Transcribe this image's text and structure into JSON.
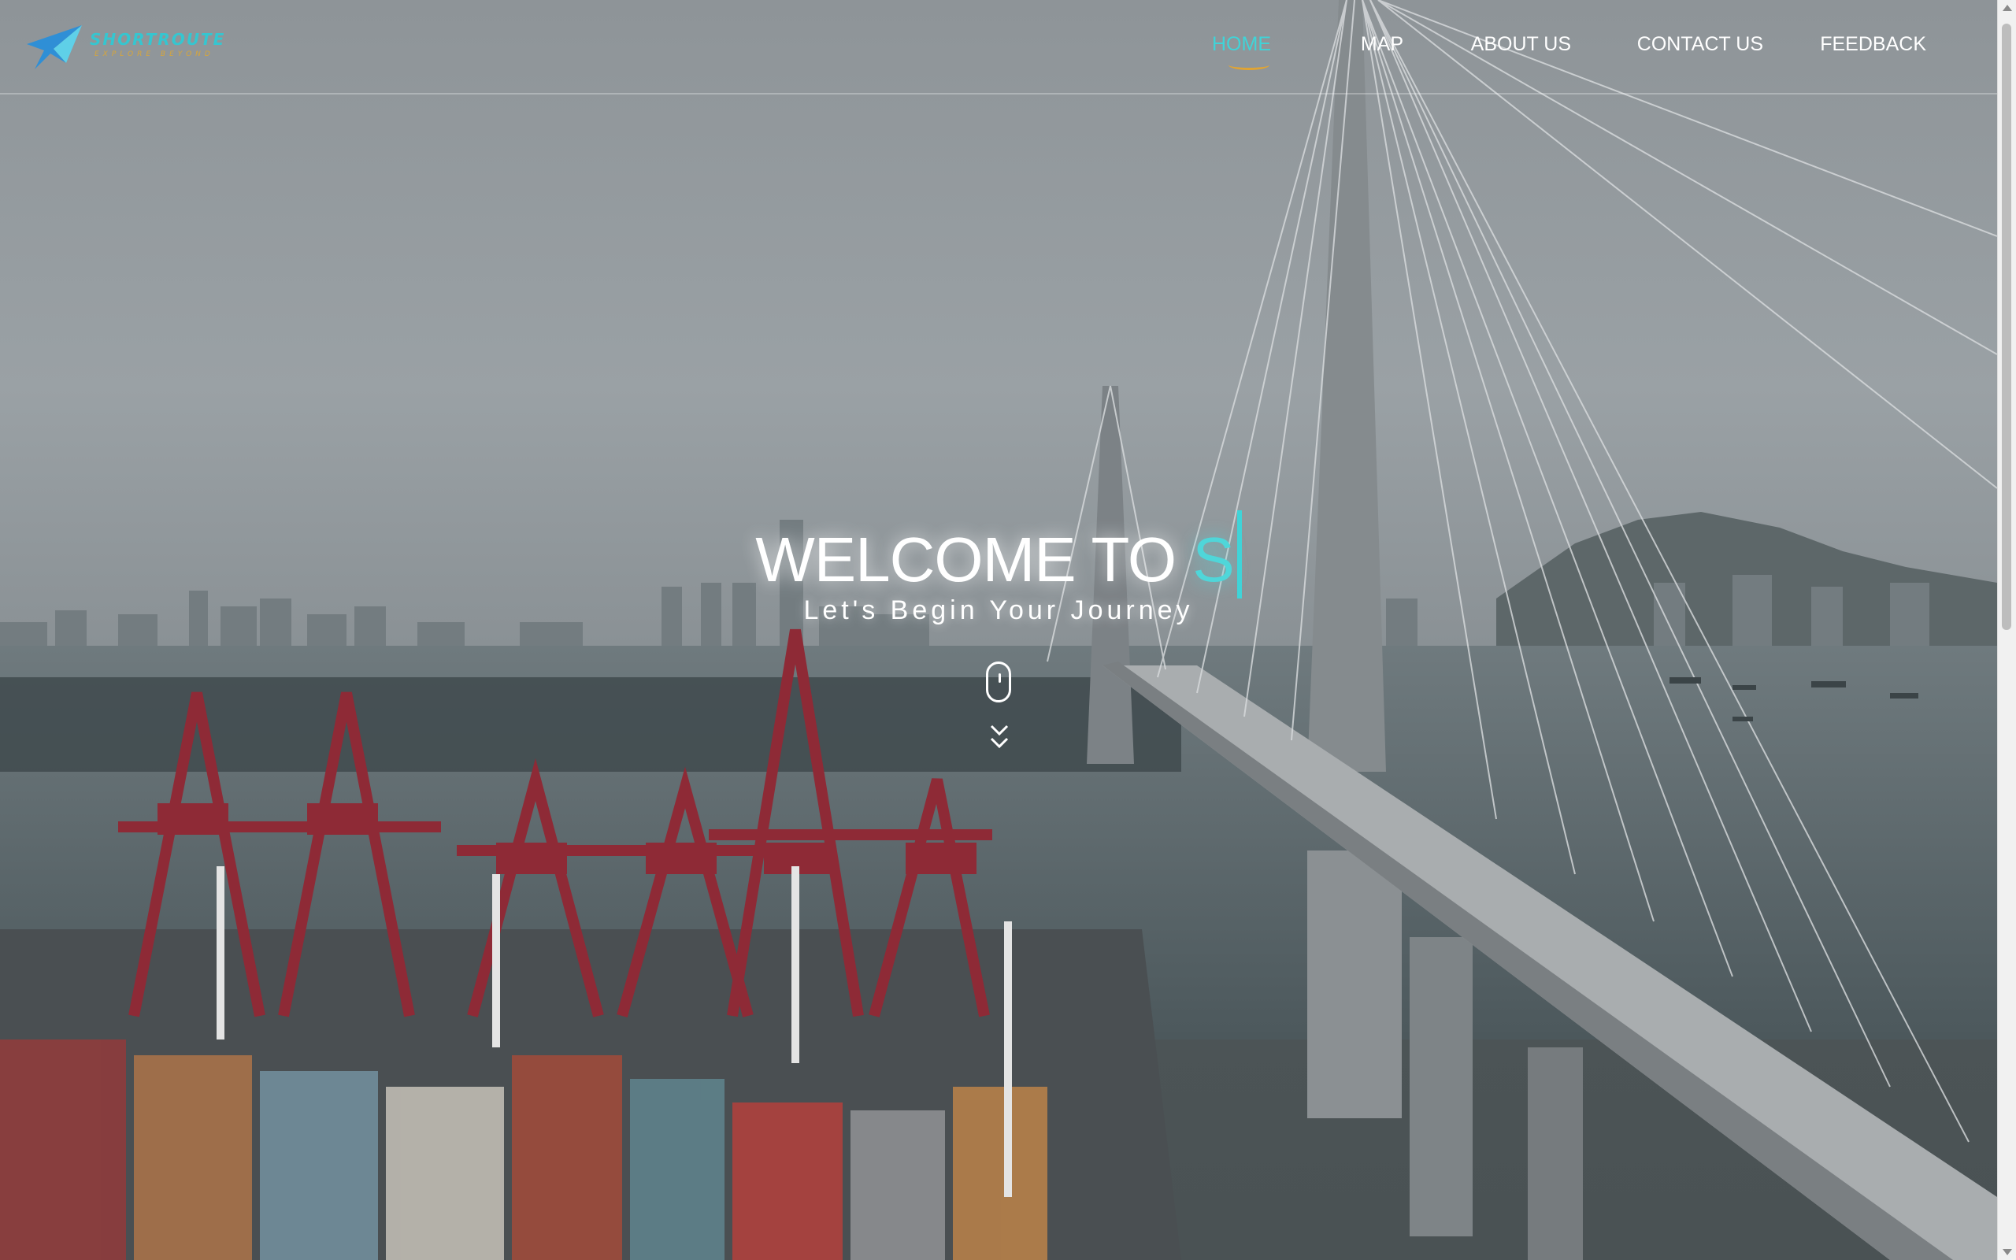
{
  "brand": {
    "name": "SHORTROUTE",
    "tagline": "EXPLORE BEYOND"
  },
  "nav": {
    "items": [
      {
        "label": "HOME",
        "active": true
      },
      {
        "label": "MAP",
        "active": false
      },
      {
        "label": "ABOUT US",
        "active": false
      },
      {
        "label": "CONTACT US",
        "active": false
      },
      {
        "label": "FEEDBACK",
        "active": false
      }
    ]
  },
  "hero": {
    "welcome": "WELCOME TO",
    "typed": "S",
    "subtitle": "Let's Begin Your Journey",
    "scroll_icon": "mouse-scroll-icon",
    "scroll_arrow_icon": "chevron-down-double-icon"
  },
  "colors": {
    "accent": "#3fd4d8",
    "underline": "#e0a434",
    "nav_text": "#ffffff"
  }
}
